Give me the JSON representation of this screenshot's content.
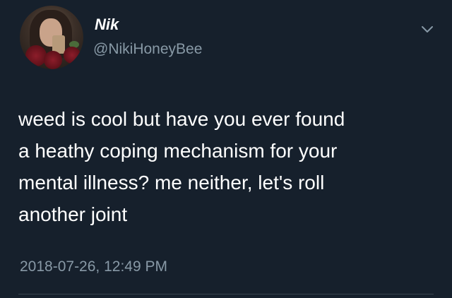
{
  "user": {
    "display_name": "Nik",
    "handle": "@NikiHoneyBee"
  },
  "tweet": {
    "text": "weed is cool but have you ever found\na heathy coping mechanism for your\nmental illness? me neither, let's roll\nanother joint",
    "timestamp": "2018-07-26, 12:49 PM"
  },
  "icons": {
    "menu": "chevron-down-icon",
    "avatar": "profile-photo"
  },
  "colors": {
    "background": "#16202c",
    "text": "#ffffff",
    "secondary_text": "#8899a6"
  }
}
